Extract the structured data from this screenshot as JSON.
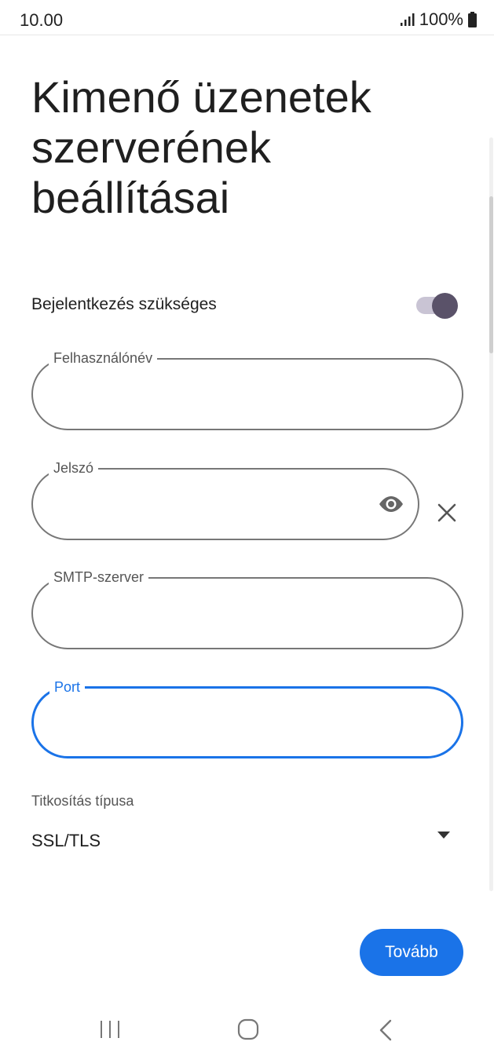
{
  "status_bar": {
    "time": "10.00",
    "battery": "100%",
    "icons": [
      "signal-icon",
      "battery-icon"
    ]
  },
  "title": "Kimenő üzenetek szerverének beállításai",
  "login_required": {
    "label": "Bejelentkezés szükséges",
    "enabled": true
  },
  "fields": {
    "username": {
      "label": "Felhasználónév",
      "value": ""
    },
    "password": {
      "label": "Jelszó",
      "value": ""
    },
    "smtp_server": {
      "label": "SMTP-szerver",
      "value": ""
    },
    "port": {
      "label": "Port",
      "value": ""
    }
  },
  "encryption": {
    "label": "Titkosítás típusa",
    "selected": "SSL/TLS"
  },
  "next_button": {
    "label": "Tovább"
  },
  "colors": {
    "accent": "#1a73e8",
    "toggle_thumb": "#5a5269",
    "toggle_track": "#c9c4d4",
    "outline": "#777777"
  },
  "nav_bar": {
    "icons": [
      "recent-apps-icon",
      "home-icon",
      "back-icon"
    ]
  }
}
